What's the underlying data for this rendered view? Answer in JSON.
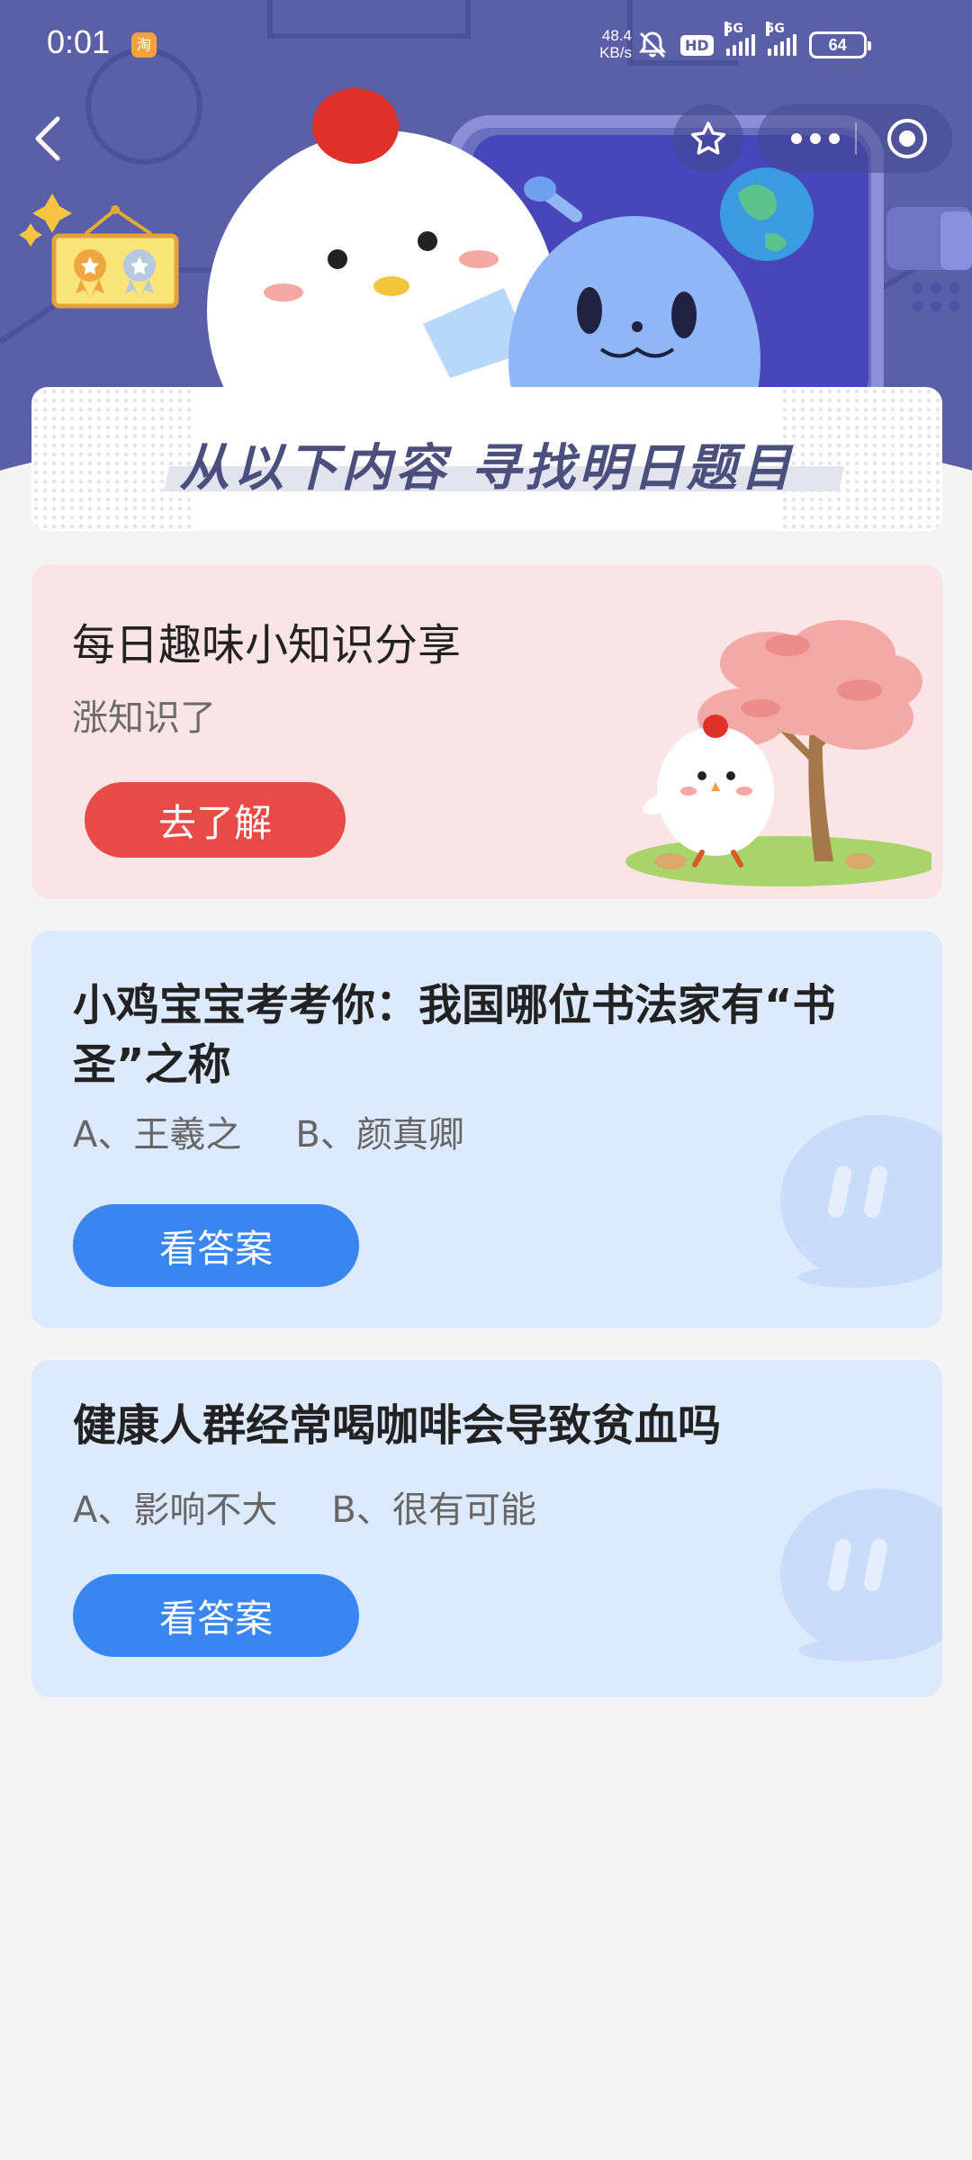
{
  "status_bar": {
    "time": "0:01",
    "app_badge": "淘",
    "net_speed_value": "48.4",
    "net_speed_unit": "KB/s",
    "hd_label": "HD",
    "sim1_label": "5G",
    "sim2_label": "5G",
    "battery": "64"
  },
  "banner": {
    "title": "从以下内容 寻找明日题目"
  },
  "knowledge_card": {
    "title": "每日趣味小知识分享",
    "subtitle": "涨知识了",
    "button_label": "去了解"
  },
  "questions": [
    {
      "title": "小鸡宝宝考考你：我国哪位书法家有“书圣”之称",
      "option_a": "A、王羲之",
      "option_b": "B、颜真卿",
      "button_label": "看答案"
    },
    {
      "title": "健康人群经常喝咖啡会导致贫血吗",
      "option_a": "A、影响不大",
      "option_b": "B、很有可能",
      "button_label": "看答案"
    }
  ],
  "colors": {
    "header_bg": "#5b5fa8",
    "pink_card": "#fbe4e5",
    "blue_card": "#dde9fc",
    "red_button": "#e84a47",
    "blue_button": "#3a86f1"
  }
}
